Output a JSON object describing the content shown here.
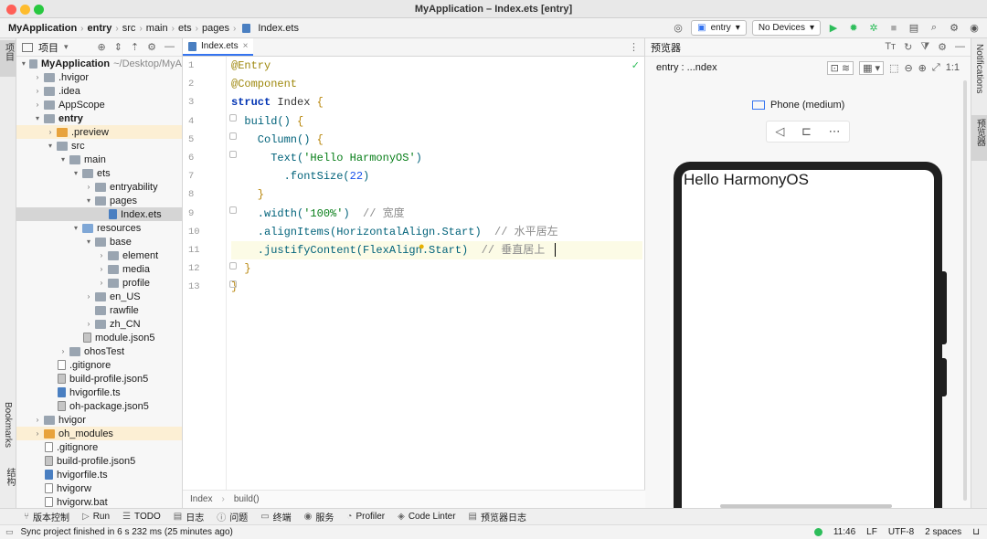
{
  "window": {
    "title": "MyApplication – Index.ets [entry]"
  },
  "breadcrumb": [
    "MyApplication",
    "entry",
    "src",
    "main",
    "ets",
    "pages",
    "Index.ets"
  ],
  "toolbar": {
    "module": "entry",
    "device": "No Devices"
  },
  "left_strip": {
    "project": "项目",
    "bookmarks": "Bookmarks",
    "structure": "结构"
  },
  "right_strip": {
    "notifications": "Notifications",
    "previewer": "预览器"
  },
  "project_panel": {
    "title": "项目"
  },
  "tree": [
    {
      "label": "MyApplication",
      "hint": "~/Desktop/MyA",
      "level": 0,
      "arrow": "open",
      "icon": "folder",
      "bold": true
    },
    {
      "label": ".hvigor",
      "level": 1,
      "arrow": "closed",
      "icon": "folder"
    },
    {
      "label": ".idea",
      "level": 1,
      "arrow": "closed",
      "icon": "folder"
    },
    {
      "label": "AppScope",
      "level": 1,
      "arrow": "closed",
      "icon": "folder"
    },
    {
      "label": "entry",
      "level": 1,
      "arrow": "open",
      "icon": "folder",
      "bold": true
    },
    {
      "label": ".preview",
      "level": 2,
      "arrow": "closed",
      "icon": "folder-orange",
      "highlight": "orange"
    },
    {
      "label": "src",
      "level": 2,
      "arrow": "open",
      "icon": "folder"
    },
    {
      "label": "main",
      "level": 3,
      "arrow": "open",
      "icon": "folder"
    },
    {
      "label": "ets",
      "level": 4,
      "arrow": "open",
      "icon": "folder"
    },
    {
      "label": "entryability",
      "level": 5,
      "arrow": "closed",
      "icon": "folder"
    },
    {
      "label": "pages",
      "level": 5,
      "arrow": "open",
      "icon": "folder"
    },
    {
      "label": "Index.ets",
      "level": 6,
      "arrow": "none",
      "icon": "file-ts",
      "selected": true
    },
    {
      "label": "resources",
      "level": 4,
      "arrow": "open",
      "icon": "folder-blue"
    },
    {
      "label": "base",
      "level": 5,
      "arrow": "open",
      "icon": "folder"
    },
    {
      "label": "element",
      "level": 6,
      "arrow": "closed",
      "icon": "folder"
    },
    {
      "label": "media",
      "level": 6,
      "arrow": "closed",
      "icon": "folder"
    },
    {
      "label": "profile",
      "level": 6,
      "arrow": "closed",
      "icon": "folder"
    },
    {
      "label": "en_US",
      "level": 5,
      "arrow": "closed",
      "icon": "folder"
    },
    {
      "label": "rawfile",
      "level": 5,
      "arrow": "none",
      "icon": "folder"
    },
    {
      "label": "zh_CN",
      "level": 5,
      "arrow": "closed",
      "icon": "folder"
    },
    {
      "label": "module.json5",
      "level": 4,
      "arrow": "none",
      "icon": "file-cfg"
    },
    {
      "label": "ohosTest",
      "level": 3,
      "arrow": "closed",
      "icon": "folder"
    },
    {
      "label": ".gitignore",
      "level": 2,
      "arrow": "none",
      "icon": "file"
    },
    {
      "label": "build-profile.json5",
      "level": 2,
      "arrow": "none",
      "icon": "file-cfg"
    },
    {
      "label": "hvigorfile.ts",
      "level": 2,
      "arrow": "none",
      "icon": "file-ts"
    },
    {
      "label": "oh-package.json5",
      "level": 2,
      "arrow": "none",
      "icon": "file-cfg"
    },
    {
      "label": "hvigor",
      "level": 1,
      "arrow": "closed",
      "icon": "folder"
    },
    {
      "label": "oh_modules",
      "level": 1,
      "arrow": "closed",
      "icon": "folder-orange",
      "highlight": "orange"
    },
    {
      "label": ".gitignore",
      "level": 1,
      "arrow": "none",
      "icon": "file"
    },
    {
      "label": "build-profile.json5",
      "level": 1,
      "arrow": "none",
      "icon": "file-cfg"
    },
    {
      "label": "hvigorfile.ts",
      "level": 1,
      "arrow": "none",
      "icon": "file-ts"
    },
    {
      "label": "hvigorw",
      "level": 1,
      "arrow": "none",
      "icon": "file"
    },
    {
      "label": "hvigorw.bat",
      "level": 1,
      "arrow": "none",
      "icon": "file"
    }
  ],
  "editor": {
    "tab": "Index.ets",
    "line_numbers": [
      "1",
      "2",
      "3",
      "4",
      "5",
      "6",
      "7",
      "8",
      "9",
      "10",
      "11",
      "12",
      "13"
    ],
    "lines": [
      [
        {
          "t": "@Entry",
          "c": "an"
        }
      ],
      [
        {
          "t": "@Component",
          "c": "an"
        }
      ],
      [
        {
          "t": "struct",
          "c": "kw"
        },
        {
          "t": " Index ",
          "c": ""
        },
        {
          "t": "{",
          "c": "br"
        }
      ],
      [
        {
          "t": "  build() ",
          "c": "fn"
        },
        {
          "t": "{",
          "c": "br"
        }
      ],
      [
        {
          "t": "    Column() ",
          "c": "fn"
        },
        {
          "t": "{",
          "c": "br"
        }
      ],
      [
        {
          "t": "      Text(",
          "c": "fn"
        },
        {
          "t": "'Hello HarmonyOS'",
          "c": "st"
        },
        {
          "t": ")",
          "c": "fn"
        }
      ],
      [
        {
          "t": "        .fontSize(",
          "c": "fn"
        },
        {
          "t": "22",
          "c": "nm"
        },
        {
          "t": ")",
          "c": "fn"
        }
      ],
      [
        {
          "t": "    }",
          "c": "br"
        }
      ],
      [
        {
          "t": "    .width(",
          "c": "fn"
        },
        {
          "t": "'100%'",
          "c": "st"
        },
        {
          "t": ")  ",
          "c": "fn"
        },
        {
          "t": "// 宽度",
          "c": "cm"
        }
      ],
      [
        {
          "t": "    .alignItems(HorizontalAlign.Start)  ",
          "c": "fn"
        },
        {
          "t": "// 水平居左",
          "c": "cm"
        }
      ],
      [
        {
          "t": "    .justifyContent(FlexAlign.Start)  ",
          "c": "fn"
        },
        {
          "t": "// 垂直居上",
          "c": "cm"
        }
      ],
      [
        {
          "t": "  }",
          "c": "br"
        }
      ],
      [
        {
          "t": "}",
          "c": "br"
        }
      ]
    ],
    "current_line": 11,
    "bottom_crumbs": [
      "Index",
      "build()"
    ]
  },
  "preview": {
    "title": "预览器",
    "target": "entry : ...ndex",
    "device_label": "Phone (medium)",
    "screen_text": "Hello HarmonyOS"
  },
  "tool_windows": [
    "版本控制",
    "Run",
    "TODO",
    "日志",
    "问题",
    "终端",
    "服务",
    "Profiler",
    "Code Linter",
    "预览器日志"
  ],
  "status": {
    "message": "Sync project finished in 6 s 232 ms (25 minutes ago)",
    "time": "11:46",
    "line_sep": "LF",
    "encoding": "UTF-8",
    "indent": "2 spaces"
  },
  "colors": {
    "accent": "#3574f0",
    "run": "#2dbd5a",
    "selection": "#d5d5d5"
  }
}
